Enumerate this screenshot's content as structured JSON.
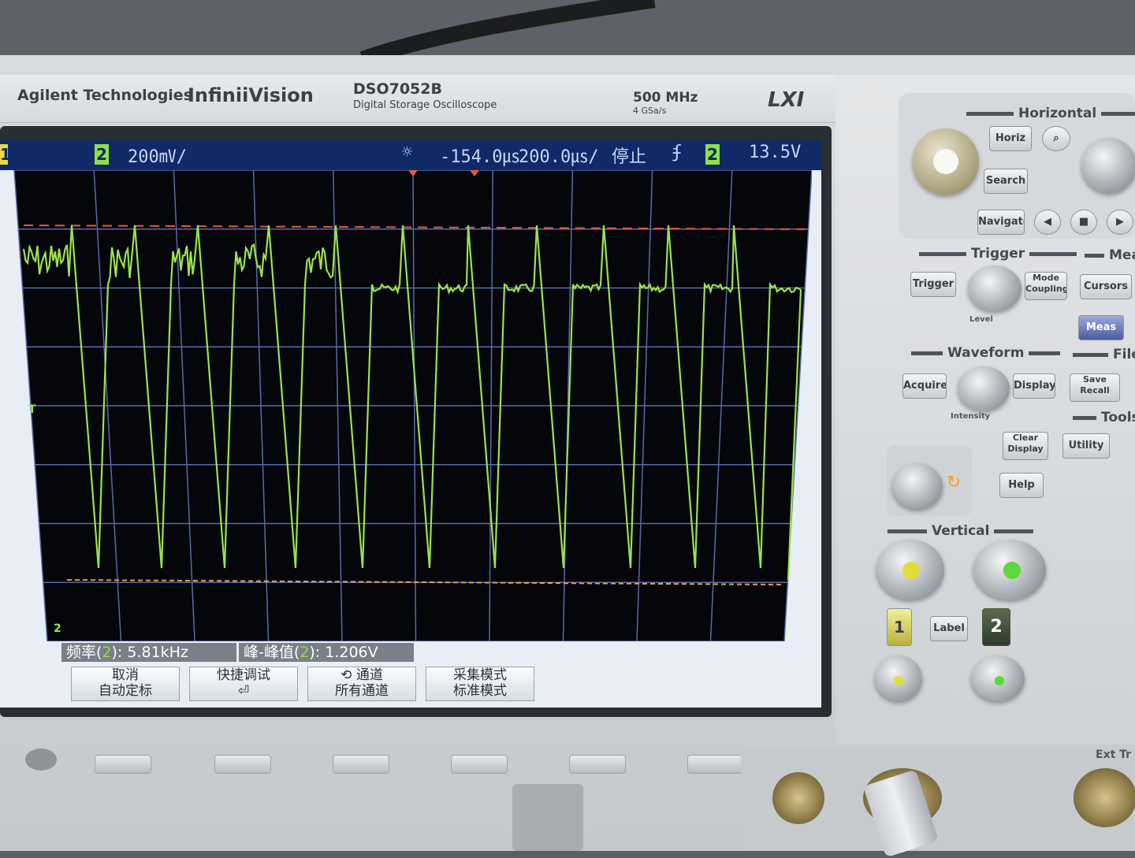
{
  "brand": {
    "maker": "Agilent Technologies",
    "series": "InfiniiVision",
    "model": "DSO7052B",
    "model_desc": "Digital Storage Oscilloscope",
    "bandwidth": "500 MHz",
    "sample_rate": "4 GSa/s",
    "lxi": "LXI"
  },
  "status": {
    "ch1_num": "1",
    "ch2_num": "2",
    "ch2_scale": "200㎷/",
    "trig_icon": "☼",
    "delay": "-154.0㎲",
    "timebase": "200.0㎲/",
    "run_state": "停止",
    "edge_icon": "ʄ",
    "trig_ch": "2",
    "trig_level": "13.5V"
  },
  "markers": {
    "ch2_ground": "2",
    "trigger_level_marker": "T"
  },
  "measurements": [
    {
      "label": "频率(",
      "ch": "2",
      "rest": "): 5.81kHz"
    },
    {
      "label": "峰-峰值(",
      "ch": "2",
      "rest": "): 1.206V"
    }
  ],
  "softkeys": [
    {
      "line1": "取消",
      "line2": "自动定标"
    },
    {
      "line1": "快捷调试",
      "line2": "⏎"
    },
    {
      "line1": "⟲  通道",
      "line2": "所有通道"
    },
    {
      "line1": "采集模式",
      "line2": "标准模式"
    }
  ],
  "panel": {
    "sections": {
      "horizontal": "Horizontal",
      "trigger": "Trigger",
      "measure": "Mea",
      "waveform": "Waveform",
      "file": "File",
      "tools": "Tools",
      "vertical": "Vertical"
    },
    "buttons": {
      "horiz": "Horiz",
      "search": "Search",
      "navigate": "Navigate",
      "trigger": "Trigger",
      "mode_coupling_1": "Mode",
      "mode_coupling_2": "Coupling",
      "cursors": "Cursors",
      "meas": "Meas",
      "acquire": "Acquire",
      "display": "Display",
      "save_recall_1": "Save",
      "save_recall_2": "Recall",
      "clear_display_1": "Clear",
      "clear_display_2": "Display",
      "utility": "Utility",
      "help": "Help",
      "label": "Label",
      "ch1": "1",
      "ch2": "2"
    },
    "labels": {
      "level": "Level",
      "intensity": "Intensity"
    },
    "ext": "Ext Tr"
  },
  "colors": {
    "trace": "#9ce24a",
    "grid": "#5a6aa8",
    "screen_bg": "#04060a",
    "cursor_dash": "#e85a3a",
    "cursor_dot": "#e8a040",
    "status_bg": "#0f2a66"
  }
}
